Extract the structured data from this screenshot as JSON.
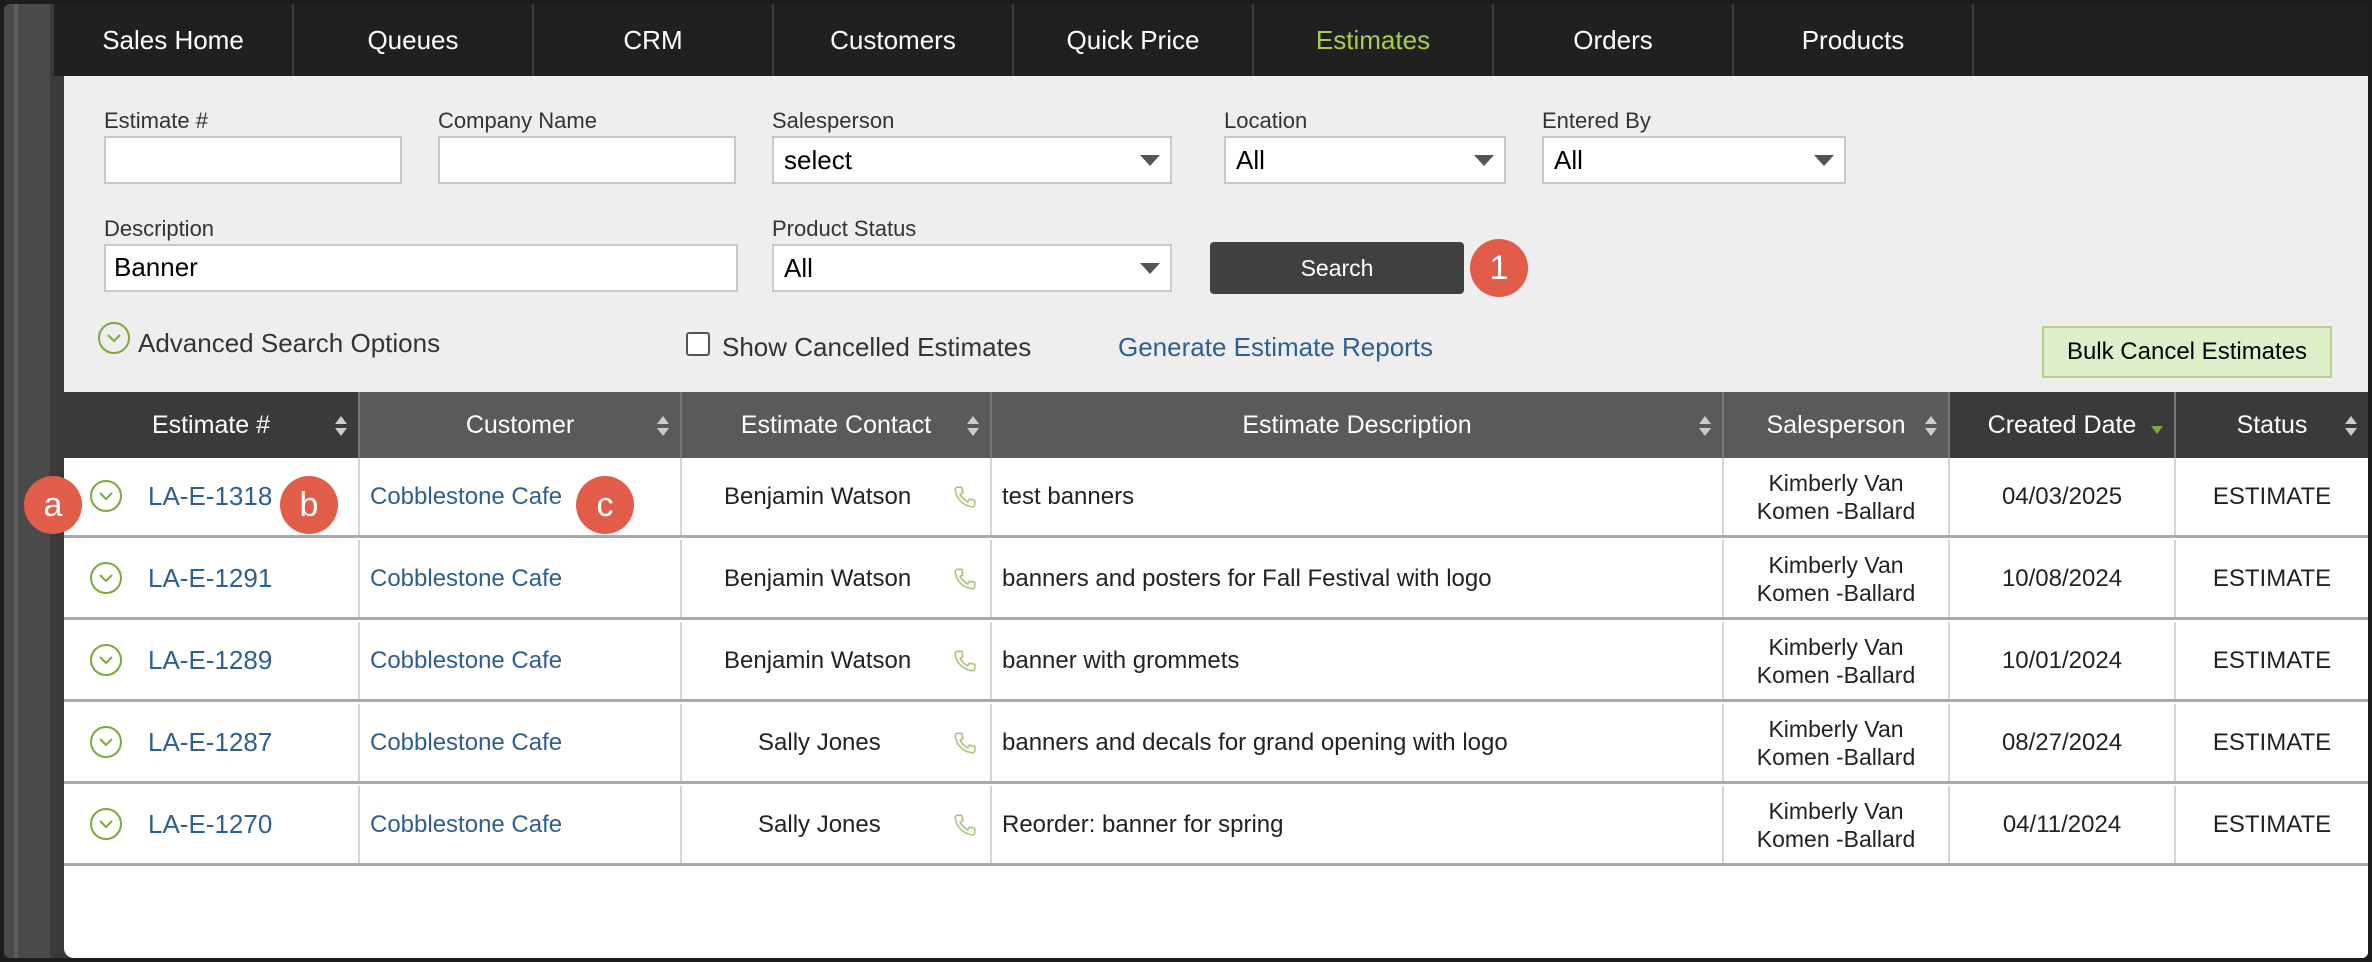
{
  "nav": {
    "tabs": [
      "Sales Home",
      "Queues",
      "CRM",
      "Customers",
      "Quick Price",
      "Estimates",
      "Orders",
      "Products"
    ],
    "active_tab": "Estimates",
    "active_color": "#a5cf4c"
  },
  "filters": {
    "estimate_number": {
      "label": "Estimate #",
      "value": ""
    },
    "company_name": {
      "label": "Company Name",
      "value": ""
    },
    "salesperson": {
      "label": "Salesperson",
      "selected": "select"
    },
    "location": {
      "label": "Location",
      "selected": "All"
    },
    "entered_by": {
      "label": "Entered By",
      "selected": "All"
    },
    "description": {
      "label": "Description",
      "value": "Banner"
    },
    "product_status": {
      "label": "Product Status",
      "selected": "All"
    },
    "search_button": "Search",
    "advanced_search": "Advanced Search Options",
    "show_cancelled": {
      "label": "Show Cancelled Estimates",
      "checked": false
    },
    "reports_link": "Generate Estimate Reports",
    "bulk_cancel": "Bulk Cancel Estimates"
  },
  "annotations": {
    "search": "1",
    "a": "a",
    "b": "b",
    "c": "c",
    "color": "#e25c4a"
  },
  "table": {
    "columns": [
      "Estimate #",
      "Customer",
      "Estimate Contact",
      "Estimate Description",
      "Salesperson",
      "Created Date",
      "Status"
    ],
    "sorted_column": "Created Date",
    "rows": [
      {
        "estimate": "LA-E-1318",
        "customer": "Cobblestone Cafe",
        "contact": "Benjamin Watson",
        "description": "test banners",
        "salesperson_line1": "Kimberly Van",
        "salesperson_line2": "Komen -Ballard",
        "created": "04/03/2025",
        "status": "ESTIMATE"
      },
      {
        "estimate": "LA-E-1291",
        "customer": "Cobblestone Cafe",
        "contact": "Benjamin Watson",
        "description": "banners and posters for Fall Festival with logo",
        "salesperson_line1": "Kimberly Van",
        "salesperson_line2": "Komen -Ballard",
        "created": "10/08/2024",
        "status": "ESTIMATE"
      },
      {
        "estimate": "LA-E-1289",
        "customer": "Cobblestone Cafe",
        "contact": "Benjamin Watson",
        "description": "banner with grommets",
        "salesperson_line1": "Kimberly Van",
        "salesperson_line2": "Komen -Ballard",
        "created": "10/01/2024",
        "status": "ESTIMATE"
      },
      {
        "estimate": "LA-E-1287",
        "customer": "Cobblestone Cafe",
        "contact": "Sally Jones",
        "description": "banners and decals for grand opening with logo",
        "salesperson_line1": "Kimberly Van",
        "salesperson_line2": "Komen -Ballard",
        "created": "08/27/2024",
        "status": "ESTIMATE"
      },
      {
        "estimate": "LA-E-1270",
        "customer": "Cobblestone Cafe",
        "contact": "Sally Jones",
        "description": "Reorder: banner for spring",
        "salesperson_line1": "Kimberly Van",
        "salesperson_line2": "Komen -Ballard",
        "created": "04/11/2024",
        "status": "ESTIMATE"
      }
    ]
  }
}
